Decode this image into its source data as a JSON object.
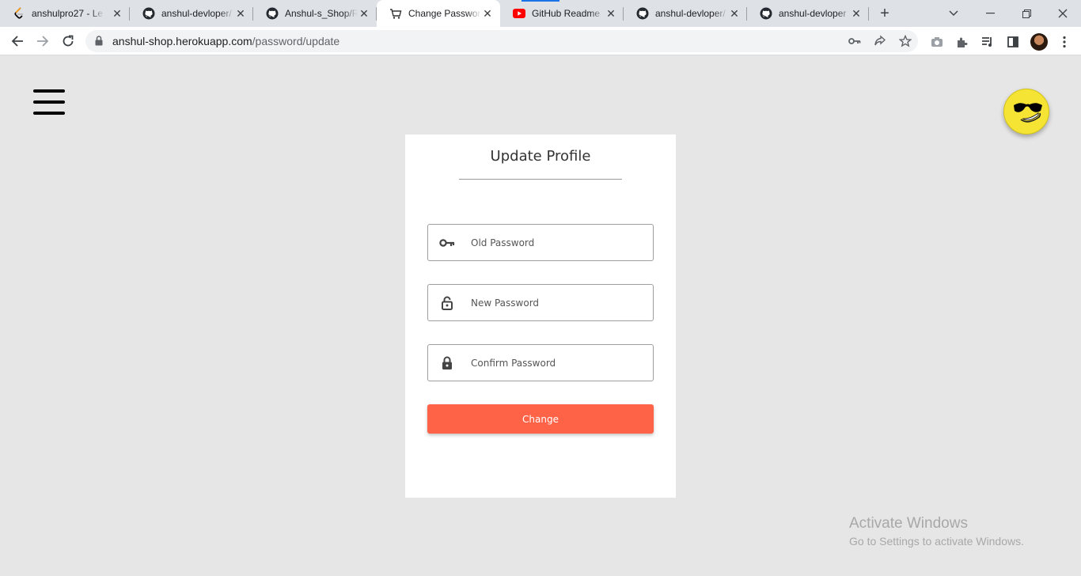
{
  "browser": {
    "tabs": [
      {
        "title": "anshulpro27 - Le",
        "icon": "leetcode-icon"
      },
      {
        "title": "anshul-devloper/",
        "icon": "github-icon"
      },
      {
        "title": "Anshul-s_Shop/R",
        "icon": "github-icon"
      },
      {
        "title": "Change Passwor",
        "icon": "cart-icon",
        "active": true
      },
      {
        "title": "GitHub Readme",
        "icon": "youtube-icon"
      },
      {
        "title": "anshul-devloper/",
        "icon": "github-icon"
      },
      {
        "title": "anshul-devloper",
        "icon": "github-icon"
      }
    ],
    "url_domain": "anshul-shop.herokuapp.com",
    "url_path": "/password/update"
  },
  "page": {
    "title": "Update Profile",
    "fields": {
      "old_password": {
        "placeholder": "Old Password",
        "icon": "key-icon"
      },
      "new_password": {
        "placeholder": "New Password",
        "icon": "lock-open-icon"
      },
      "confirm_password": {
        "placeholder": "Confirm Password",
        "icon": "lock-icon"
      }
    },
    "submit_label": "Change",
    "accent_color": "#ff6347"
  },
  "watermark": {
    "line1": "Activate Windows",
    "line2": "Go to Settings to activate Windows."
  }
}
